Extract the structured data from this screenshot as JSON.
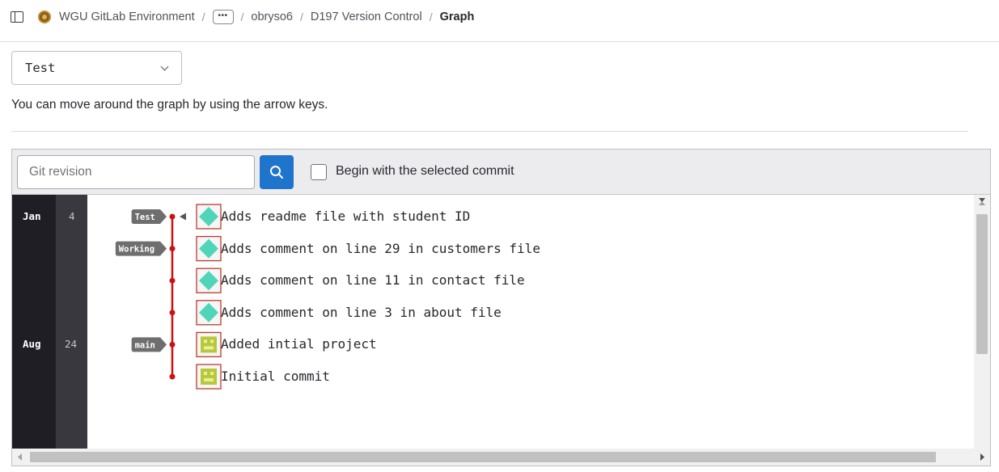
{
  "breadcrumb": {
    "org": "WGU GitLab Environment",
    "ellipsis": "•••",
    "user": "obryso6",
    "project": "D197 Version Control",
    "current": "Graph",
    "separator": "/"
  },
  "branch_select": {
    "value": "Test"
  },
  "hint": "You can move around the graph by using the arrow keys.",
  "toolbar": {
    "revision_placeholder": "Git revision",
    "checkbox_label": "Begin with the selected commit",
    "checkbox_checked": false
  },
  "graph": {
    "months": [
      {
        "label": "Jan",
        "row": 0
      },
      {
        "label": "Aug",
        "row": 4
      }
    ],
    "days": [
      {
        "label": "4",
        "row": 0
      },
      {
        "label": "24",
        "row": 4
      }
    ],
    "refs": [
      {
        "label": "Test",
        "row": 0,
        "head": true
      },
      {
        "label": "Working",
        "row": 1,
        "head": false
      },
      {
        "label": "main",
        "row": 4,
        "head": false
      }
    ],
    "commits": [
      {
        "message": "Adds readme file with student ID",
        "avatar": "teal"
      },
      {
        "message": "Adds comment on line 29 in customers file",
        "avatar": "teal"
      },
      {
        "message": "Adds comment on line 11 in contact file",
        "avatar": "teal"
      },
      {
        "message": "Adds comment on line 3 in about file",
        "avatar": "teal"
      },
      {
        "message": "Added intial project",
        "avatar": "olive"
      },
      {
        "message": "Initial commit",
        "avatar": "olive"
      }
    ],
    "colors": {
      "branch_line": "#cc1111",
      "ref_label_bg": "#6e6e6e",
      "avatar_teal": "#4fd6b8",
      "avatar_olive": "#b9c83a",
      "avatar_border": "#c0392b"
    }
  }
}
